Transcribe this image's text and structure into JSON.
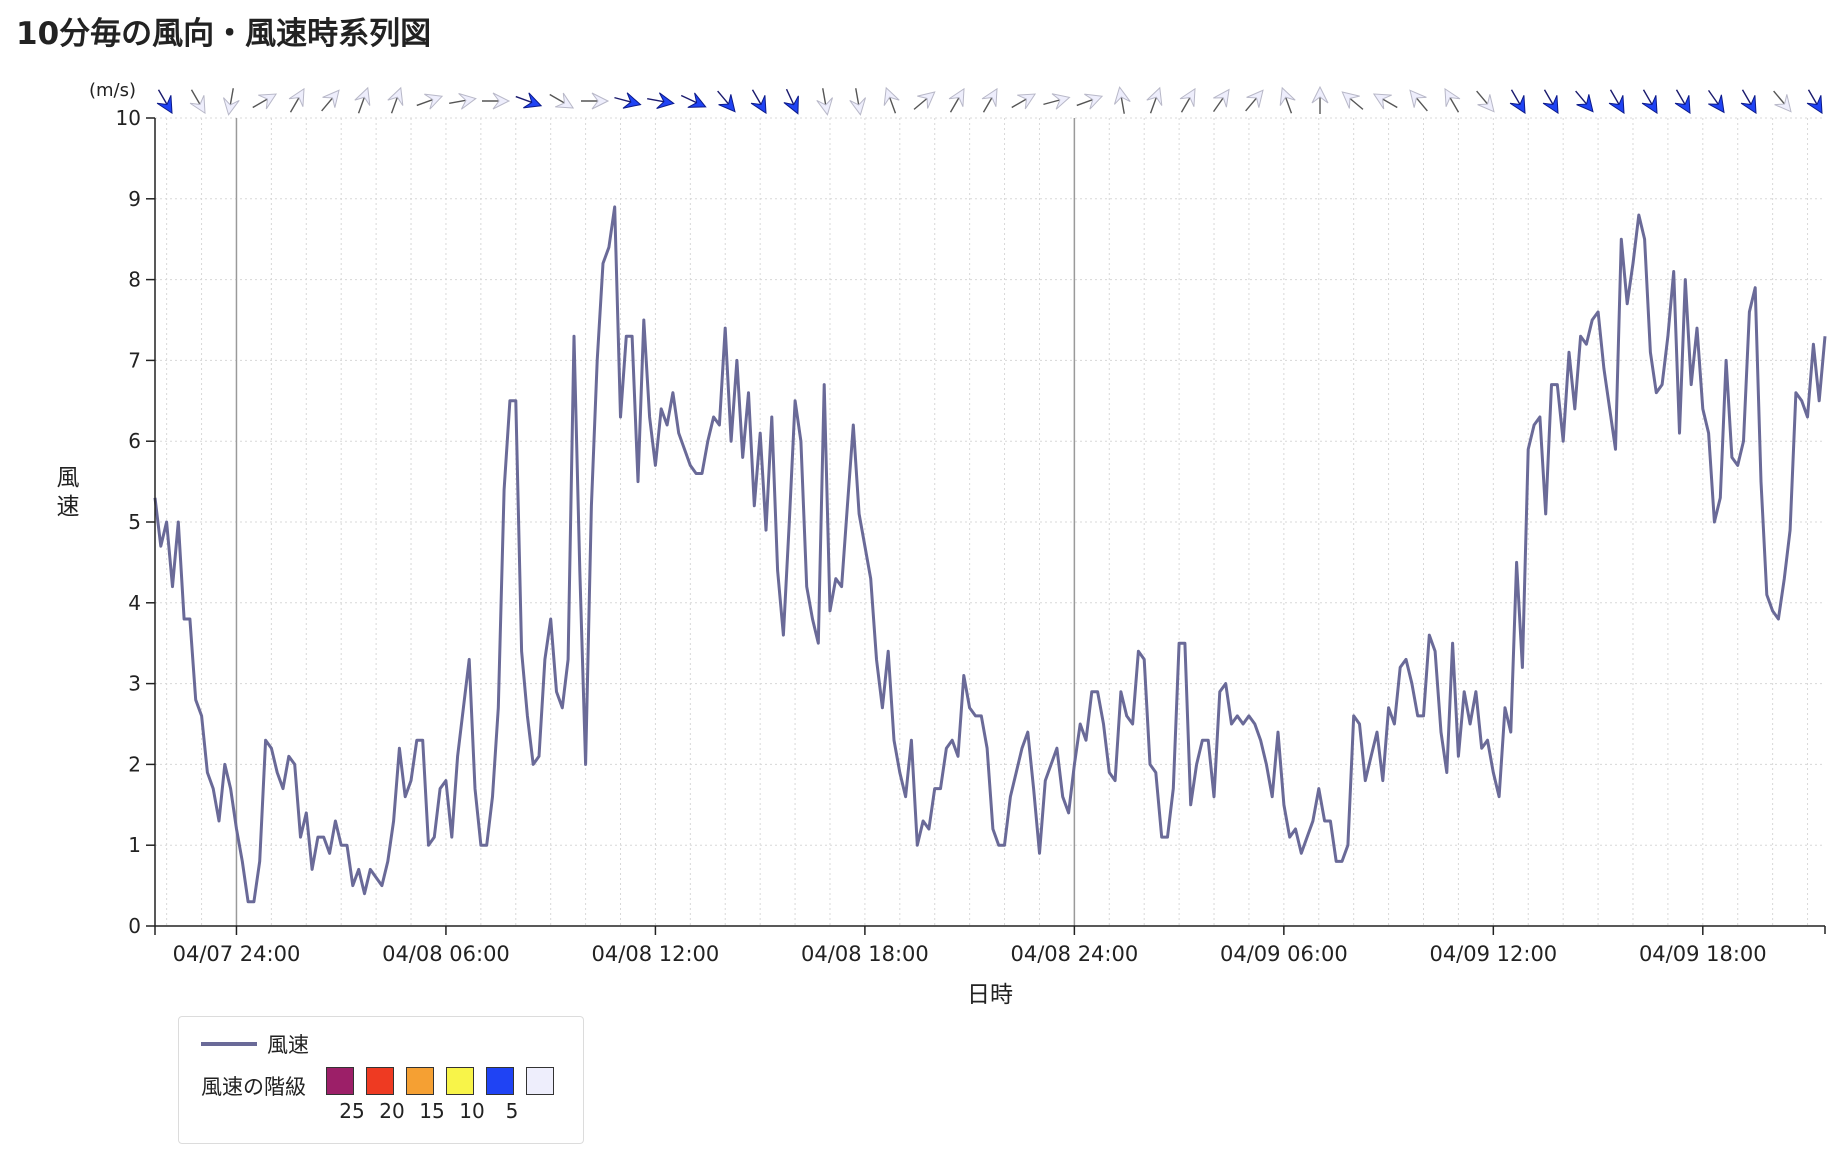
{
  "title": "10分毎の風向・風速時系列図",
  "chart_data": {
    "type": "line",
    "ylabel": "風速",
    "xlabel": "日時",
    "unit_label": "(m/s)",
    "ylim": [
      0,
      10
    ],
    "yticks": [
      0,
      1,
      2,
      3,
      4,
      5,
      6,
      7,
      8,
      9,
      10
    ],
    "grid": true,
    "interval_minutes": 10,
    "x_ticks": [
      {
        "label": "04/07 24:00"
      },
      {
        "label": "04/08 06:00"
      },
      {
        "label": "04/08 12:00"
      },
      {
        "label": "04/08 18:00"
      },
      {
        "label": "04/08 24:00"
      },
      {
        "label": "04/09 06:00"
      },
      {
        "label": "04/09 12:00"
      },
      {
        "label": "04/09 18:00"
      }
    ],
    "series": [
      {
        "name": "風速",
        "color": "#6a6a98",
        "values": [
          5.3,
          4.7,
          5.0,
          4.2,
          5.0,
          3.8,
          3.8,
          2.8,
          2.6,
          1.9,
          1.7,
          1.3,
          2.0,
          1.7,
          1.2,
          0.8,
          0.3,
          0.3,
          0.8,
          2.3,
          2.2,
          1.9,
          1.7,
          2.1,
          2.0,
          1.1,
          1.4,
          0.7,
          1.1,
          1.1,
          0.9,
          1.3,
          1.0,
          1.0,
          0.5,
          0.7,
          0.4,
          0.7,
          0.6,
          0.5,
          0.8,
          1.3,
          2.2,
          1.6,
          1.8,
          2.3,
          2.3,
          1.0,
          1.1,
          1.7,
          1.8,
          1.1,
          2.1,
          2.7,
          3.3,
          1.7,
          1.0,
          1.0,
          1.6,
          2.7,
          5.4,
          6.5,
          6.5,
          3.4,
          2.6,
          2.0,
          2.1,
          3.3,
          3.8,
          2.9,
          2.7,
          3.3,
          7.3,
          4.4,
          2.0,
          5.2,
          7.0,
          8.2,
          8.4,
          8.9,
          6.3,
          7.3,
          7.3,
          5.5,
          7.5,
          6.3,
          5.7,
          6.4,
          6.2,
          6.6,
          6.1,
          5.9,
          5.7,
          5.6,
          5.6,
          6.0,
          6.3,
          6.2,
          7.4,
          6.0,
          7.0,
          5.8,
          6.6,
          5.2,
          6.1,
          4.9,
          6.3,
          4.4,
          3.6,
          5.0,
          6.5,
          6.0,
          4.2,
          3.8,
          3.5,
          6.7,
          3.9,
          4.3,
          4.2,
          5.2,
          6.2,
          5.1,
          4.7,
          4.3,
          3.3,
          2.7,
          3.4,
          2.3,
          1.9,
          1.6,
          2.3,
          1.0,
          1.3,
          1.2,
          1.7,
          1.7,
          2.2,
          2.3,
          2.1,
          3.1,
          2.7,
          2.6,
          2.6,
          2.2,
          1.2,
          1.0,
          1.0,
          1.6,
          1.9,
          2.2,
          2.4,
          1.7,
          0.9,
          1.8,
          2.0,
          2.2,
          1.6,
          1.4,
          2.0,
          2.5,
          2.3,
          2.9,
          2.9,
          2.5,
          1.9,
          1.8,
          2.9,
          2.6,
          2.5,
          3.4,
          3.3,
          2.0,
          1.9,
          1.1,
          1.1,
          1.7,
          3.5,
          3.5,
          1.5,
          2.0,
          2.3,
          2.3,
          1.6,
          2.9,
          3.0,
          2.5,
          2.6,
          2.5,
          2.6,
          2.5,
          2.3,
          2.0,
          1.6,
          2.4,
          1.5,
          1.1,
          1.2,
          0.9,
          1.1,
          1.3,
          1.7,
          1.3,
          1.3,
          0.8,
          0.8,
          1.0,
          2.6,
          2.5,
          1.8,
          2.1,
          2.4,
          1.8,
          2.7,
          2.5,
          3.2,
          3.3,
          3.0,
          2.6,
          2.6,
          3.6,
          3.4,
          2.4,
          1.9,
          3.5,
          2.1,
          2.9,
          2.5,
          2.9,
          2.2,
          2.3,
          1.9,
          1.6,
          2.7,
          2.4,
          4.5,
          3.2,
          5.9,
          6.2,
          6.3,
          5.1,
          6.7,
          6.7,
          6.0,
          7.1,
          6.4,
          7.3,
          7.2,
          7.5,
          7.6,
          6.9,
          6.4,
          5.9,
          8.5,
          7.7,
          8.2,
          8.8,
          8.5,
          7.1,
          6.6,
          6.7,
          7.3,
          8.1,
          6.1,
          8.0,
          6.7,
          7.4,
          6.4,
          6.1,
          5.0,
          5.3,
          7.0,
          5.8,
          5.7,
          6.0,
          7.6,
          7.9,
          5.5,
          4.1,
          3.9,
          3.8,
          4.3,
          4.9,
          6.6,
          6.5,
          6.3,
          7.2,
          6.5,
          7.3
        ]
      }
    ],
    "wind_direction_arrows": [
      {
        "speed": 9,
        "dir_deg": 330
      },
      {
        "speed": 2,
        "dir_deg": 330
      },
      {
        "speed": 2,
        "dir_deg": 10
      },
      {
        "speed": 2,
        "dir_deg": 240
      },
      {
        "speed": 2,
        "dir_deg": 210
      },
      {
        "speed": 2,
        "dir_deg": 220
      },
      {
        "speed": 2,
        "dir_deg": 200
      },
      {
        "speed": 2,
        "dir_deg": 200
      },
      {
        "speed": 2,
        "dir_deg": 250
      },
      {
        "speed": 2,
        "dir_deg": 260
      },
      {
        "speed": 2,
        "dir_deg": 270
      },
      {
        "speed": 7,
        "dir_deg": 290
      },
      {
        "speed": 2,
        "dir_deg": 300
      },
      {
        "speed": 2,
        "dir_deg": 270
      },
      {
        "speed": 8,
        "dir_deg": 285
      },
      {
        "speed": 9,
        "dir_deg": 280
      },
      {
        "speed": 9,
        "dir_deg": 295
      },
      {
        "speed": 9,
        "dir_deg": 320
      },
      {
        "speed": 9,
        "dir_deg": 330
      },
      {
        "speed": 8,
        "dir_deg": 335
      },
      {
        "speed": 2,
        "dir_deg": 350
      },
      {
        "speed": 2,
        "dir_deg": 350
      },
      {
        "speed": 2,
        "dir_deg": 160
      },
      {
        "speed": 2,
        "dir_deg": 230
      },
      {
        "speed": 2,
        "dir_deg": 210
      },
      {
        "speed": 2,
        "dir_deg": 210
      },
      {
        "speed": 2,
        "dir_deg": 240
      },
      {
        "speed": 2,
        "dir_deg": 255
      },
      {
        "speed": 2,
        "dir_deg": 250
      },
      {
        "speed": 2,
        "dir_deg": 170
      },
      {
        "speed": 2,
        "dir_deg": 200
      },
      {
        "speed": 2,
        "dir_deg": 210
      },
      {
        "speed": 2,
        "dir_deg": 215
      },
      {
        "speed": 2,
        "dir_deg": 220
      },
      {
        "speed": 2,
        "dir_deg": 160
      },
      {
        "speed": 2,
        "dir_deg": 180
      },
      {
        "speed": 2,
        "dir_deg": 130
      },
      {
        "speed": 2,
        "dir_deg": 120
      },
      {
        "speed": 2,
        "dir_deg": 140
      },
      {
        "speed": 2,
        "dir_deg": 150
      },
      {
        "speed": 2,
        "dir_deg": 320
      },
      {
        "speed": 9,
        "dir_deg": 330
      },
      {
        "speed": 9,
        "dir_deg": 330
      },
      {
        "speed": 9,
        "dir_deg": 320
      },
      {
        "speed": 9,
        "dir_deg": 330
      },
      {
        "speed": 9,
        "dir_deg": 330
      },
      {
        "speed": 9,
        "dir_deg": 330
      },
      {
        "speed": 9,
        "dir_deg": 325
      },
      {
        "speed": 9,
        "dir_deg": 330
      },
      {
        "speed": 2,
        "dir_deg": 320
      },
      {
        "speed": 9,
        "dir_deg": 330
      }
    ]
  },
  "legend": {
    "series_label": "風速",
    "class_label": "風速の階級",
    "classes": [
      {
        "value": "25",
        "color": "#9c1f68"
      },
      {
        "value": "20",
        "color": "#ee3a22"
      },
      {
        "value": "15",
        "color": "#f5a033"
      },
      {
        "value": "10",
        "color": "#f8f449"
      },
      {
        "value": "5",
        "color": "#1f43f4"
      },
      {
        "value": "",
        "color": "#eeeefc"
      }
    ]
  }
}
